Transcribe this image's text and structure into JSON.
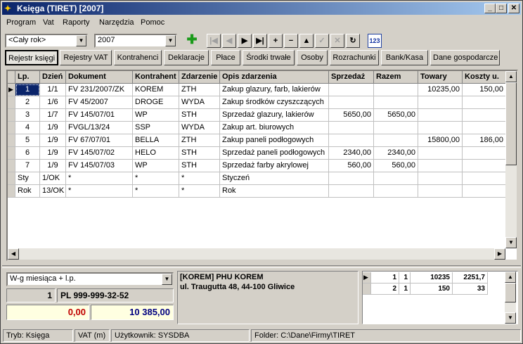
{
  "window": {
    "title": "Księga (TIRET)  [2007]"
  },
  "menu": [
    "Program",
    "Vat",
    "Raporty",
    "Narzędzia",
    "Pomoc"
  ],
  "filters": {
    "period": "<Cały rok>",
    "year": "2007"
  },
  "icons": {
    "add": "plus-circle-icon",
    "calc": "calculator-123-icon"
  },
  "calc_label": "123",
  "nav_buttons": [
    "|◀",
    "◀",
    "▶",
    "▶|",
    "+",
    "−",
    "▲",
    "✓",
    "✕",
    "↻"
  ],
  "tabs": [
    "Rejestr księgi",
    "Rejestry VAT",
    "Kontrahenci",
    "Deklaracje",
    "Płace",
    "Środki trwałe",
    "Osoby",
    "Rozrachunki",
    "Bank/Kasa",
    "Dane gospodarcze"
  ],
  "active_tab": "Rejestr księgi",
  "grid": {
    "columns": [
      "Lp.",
      "Dzień",
      "Dokument",
      "Kontrahent",
      "Zdarzenie",
      "Opis zdarzenia",
      "Sprzedaż",
      "Razem",
      "Towary",
      "Koszty u."
    ],
    "rows": [
      [
        "1",
        "1/1",
        "FV 231/2007/ZK",
        "KOREM",
        "ZTH",
        "Zakup glazury, farb, lakierów",
        "",
        "",
        "10235,00",
        "150,00"
      ],
      [
        "2",
        "1/6",
        "FV 45/2007",
        "DROGE",
        "WYDA",
        "Zakup środków czyszczących",
        "",
        "",
        "",
        ""
      ],
      [
        "3",
        "1/7",
        "FV 145/07/01",
        "WP",
        "STH",
        "Sprzedaż glazury, lakierów",
        "5650,00",
        "5650,00",
        "",
        ""
      ],
      [
        "4",
        "1/9",
        "FVGL/13/24",
        "SSP",
        "WYDA",
        "Zakup art. biurowych",
        "",
        "",
        "",
        ""
      ],
      [
        "5",
        "1/9",
        "FV  67/07/01",
        "BELLA",
        "ZTH",
        "Zakup paneli podłogowych",
        "",
        "",
        "15800,00",
        "186,00"
      ],
      [
        "6",
        "1/9",
        "FV 145/07/02",
        "HELO",
        "STH",
        "Sprzedaż paneli podłogowych",
        "2340,00",
        "2340,00",
        "",
        ""
      ],
      [
        "7",
        "1/9",
        "FV 145/07/03",
        "WP",
        "STH",
        "Sprzedaż farby akrylowej",
        "560,00",
        "560,00",
        "",
        ""
      ],
      [
        "Sty",
        "1/OK",
        "*",
        "*",
        "*",
        "Styczeń",
        "",
        "",
        "",
        ""
      ],
      [
        "Rok",
        "13/OK",
        "*",
        "*",
        "*",
        "Rok",
        "",
        "",
        "",
        ""
      ]
    ]
  },
  "bottom": {
    "sort_combo": "W-g miesiąca + l.p.",
    "count": "1",
    "nip": "PL 999-999-32-52",
    "amount1": "0,00",
    "amount2": "10 385,00",
    "contractor_line1": "[KOREM] PHU KOREM",
    "contractor_line2": "ul. Traugutta 48, 44-100 Gliwice",
    "mini_rows": [
      [
        "1",
        "1",
        "10235",
        "2251,7"
      ],
      [
        "2",
        "1",
        "150",
        "33"
      ]
    ]
  },
  "status": {
    "mode": "Tryb: Księga",
    "vat": "VAT (m)",
    "user": "Użytkownik: SYSDBA",
    "folder": "Folder: C:\\Dane\\Firmy\\TIRET"
  }
}
